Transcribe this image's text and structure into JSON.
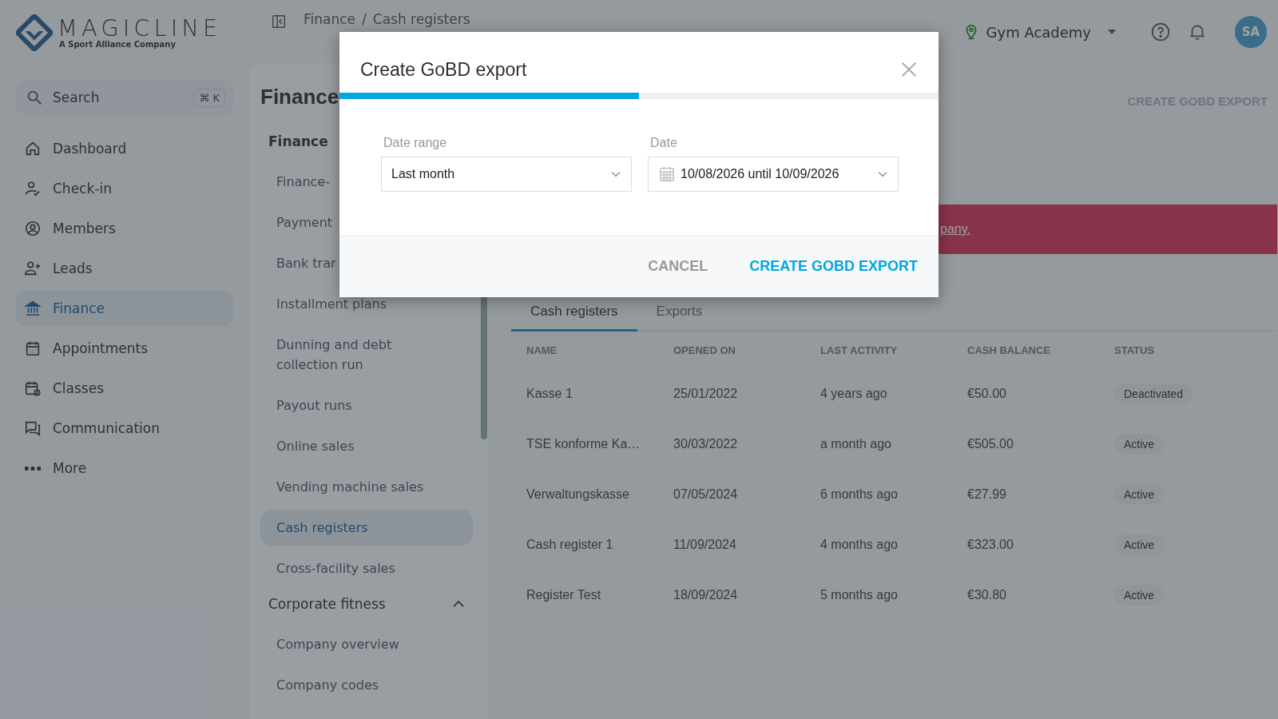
{
  "sidebar": {
    "logo": "MAGICLINE",
    "tagline": "A Sport Alliance Company",
    "search": {
      "placeholder": "Search",
      "shortcut": "⌘ K"
    },
    "items": [
      {
        "label": "Dashboard",
        "selected": false
      },
      {
        "label": "Check-in",
        "selected": false
      },
      {
        "label": "Members",
        "selected": false
      },
      {
        "label": "Leads",
        "selected": false
      },
      {
        "label": "Finance",
        "selected": true
      },
      {
        "label": "Appointments",
        "selected": false
      },
      {
        "label": "Classes",
        "selected": false
      },
      {
        "label": "Communication",
        "selected": false
      },
      {
        "label": "More",
        "selected": false
      }
    ]
  },
  "topbar": {
    "breadcrumb": [
      "Finance",
      "Cash registers"
    ],
    "separator": "/",
    "location": "Gym Academy",
    "avatar": "SA"
  },
  "subnav": {
    "title": "Finance",
    "section": "Finance",
    "items": [
      {
        "label": "Finance-",
        "selected": false
      },
      {
        "label": "Payment",
        "selected": false
      },
      {
        "label": "Bank trar",
        "selected": false
      },
      {
        "label": "Installment plans",
        "selected": false
      },
      {
        "label": "Dunning and debt collection run",
        "selected": false
      },
      {
        "label": "Payout runs",
        "selected": false
      },
      {
        "label": "Online sales",
        "selected": false
      },
      {
        "label": "Vending machine sales",
        "selected": false
      },
      {
        "label": "Cash registers",
        "selected": true
      },
      {
        "label": "Cross-facility sales",
        "selected": false
      }
    ],
    "group": {
      "label": "Corporate fitness",
      "expanded": true,
      "children": [
        {
          "label": "Company overview",
          "selected": false
        },
        {
          "label": "Company codes",
          "selected": false
        }
      ]
    }
  },
  "content": {
    "action": "CREATE GOBD EXPORT",
    "banner_link": "pany.",
    "tabs": [
      {
        "label": "Cash registers",
        "selected": true
      },
      {
        "label": "Exports",
        "selected": false
      }
    ],
    "table": {
      "columns": [
        "NAME",
        "OPENED ON",
        "LAST ACTIVITY",
        "CASH BALANCE",
        "STATUS"
      ],
      "rows": [
        [
          "Kasse 1",
          "25/01/2022",
          "4 years ago",
          "€50.00",
          "Deactivated"
        ],
        [
          "TSE konforme Ka…",
          "30/03/2022",
          "a month ago",
          "€505.00",
          "Active"
        ],
        [
          "Verwaltungskasse",
          "07/05/2024",
          "6 months ago",
          "€27.99",
          "Active"
        ],
        [
          "Cash register 1",
          "11/09/2024",
          "4 months ago",
          "€323.00",
          "Active"
        ],
        [
          "Register Test",
          "18/09/2024",
          "5 months ago",
          "€30.80",
          "Active"
        ]
      ]
    }
  },
  "modal": {
    "title": "Create GoBD export",
    "progress": {
      "level": 0.5
    },
    "fields": [
      {
        "kind": "select",
        "label": "Date range",
        "value": "Last month"
      },
      {
        "kind": "date",
        "label": "Date",
        "value": "10/08/2026 until 10/09/2026"
      }
    ],
    "buttons": [
      {
        "label": "CANCEL",
        "kind": "secondary"
      },
      {
        "label": "CREATE GOBD EXPORT",
        "kind": "primary"
      }
    ]
  }
}
